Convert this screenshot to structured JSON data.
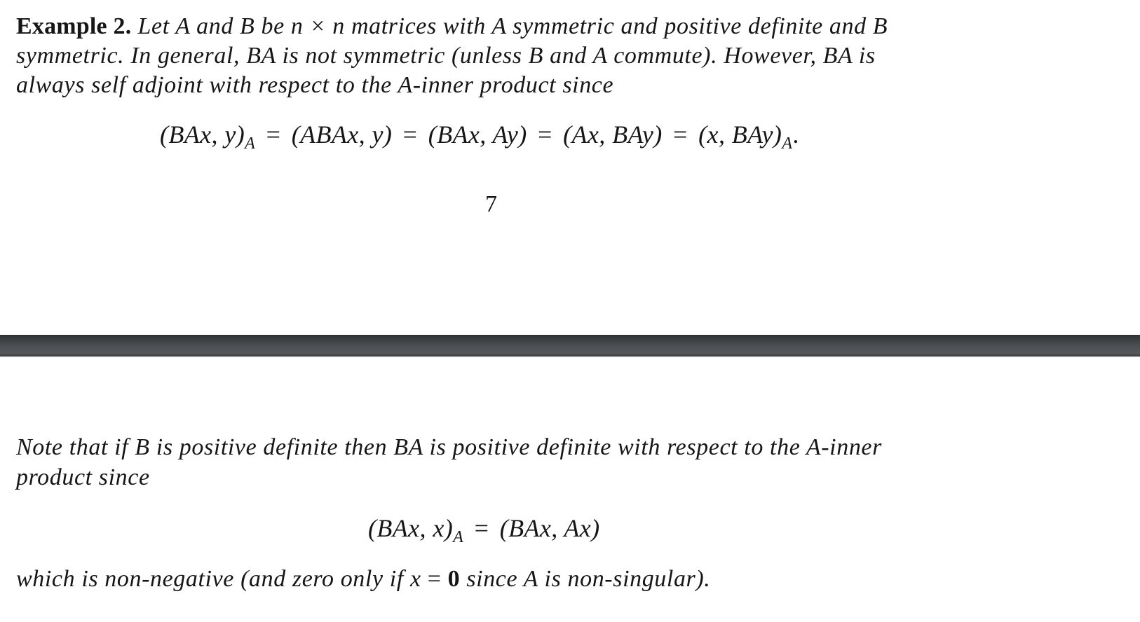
{
  "document": {
    "page_top": {
      "example_label": "Example 2.",
      "lines": [
        "Let A and B be n × n matrices with A symmetric and positive definite and B",
        "symmetric. In general, BA is not symmetric (unless B and A commute). However, BA is",
        "always self adjoint with respect to the A-inner product since"
      ],
      "line1_rest": " Let A and B be n × n matrices with A symmetric and positive definite and B",
      "equation": {
        "t1": "(BAx, y)",
        "t1_sub": "A",
        "eq1": "=",
        "t2": "(ABAx, y)",
        "eq2": "=",
        "t3": "(BAx, Ay)",
        "eq3": "=",
        "t4": "(Ax, BAy)",
        "eq4": "=",
        "t5": "(x, BAy)",
        "t5_sub": "A",
        "end": "."
      },
      "page_number": "7"
    },
    "page_bottom": {
      "lines": [
        "Note that if B is positive definite then BA is positive definite with respect to the A-inner",
        "product since"
      ],
      "equation": {
        "lhs": "(BAx, x)",
        "lhs_sub": "A",
        "eq": "=",
        "rhs": "(BAx, Ax)"
      },
      "closing": {
        "before": "which is non-negative (and zero only if ",
        "var": "x",
        "eq": " = ",
        "zero": "0",
        "after": " since A is non-singular)."
      }
    }
  }
}
